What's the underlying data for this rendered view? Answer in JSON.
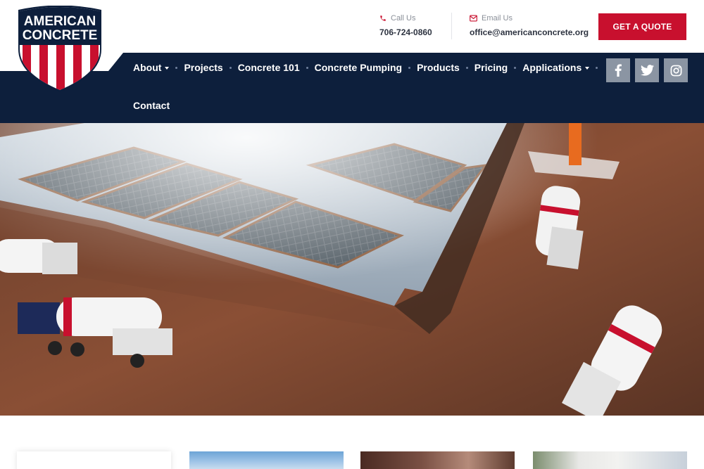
{
  "brand": {
    "logo_line1": "AMERICAN",
    "logo_line2": "CONCRETE",
    "colors": {
      "navy": "#0d1f3c",
      "red": "#c8102e",
      "white": "#ffffff"
    }
  },
  "header": {
    "call": {
      "label": "Call Us",
      "value": "706-724-0860",
      "icon": "phone-icon"
    },
    "email": {
      "label": "Email Us",
      "value": "office@americanconcrete.org",
      "icon": "envelope-icon"
    },
    "quote_button": "GET A QUOTE"
  },
  "nav": {
    "items": [
      {
        "label": "About",
        "dropdown": true
      },
      {
        "label": "Projects",
        "dropdown": false
      },
      {
        "label": "Concrete 101",
        "dropdown": false
      },
      {
        "label": "Concrete Pumping",
        "dropdown": false
      },
      {
        "label": "Products",
        "dropdown": false
      },
      {
        "label": "Pricing",
        "dropdown": false
      },
      {
        "label": "Applications",
        "dropdown": true
      },
      {
        "label": "Contact",
        "dropdown": false
      }
    ]
  },
  "socials": [
    "facebook-icon",
    "twitter-icon",
    "instagram-icon"
  ]
}
